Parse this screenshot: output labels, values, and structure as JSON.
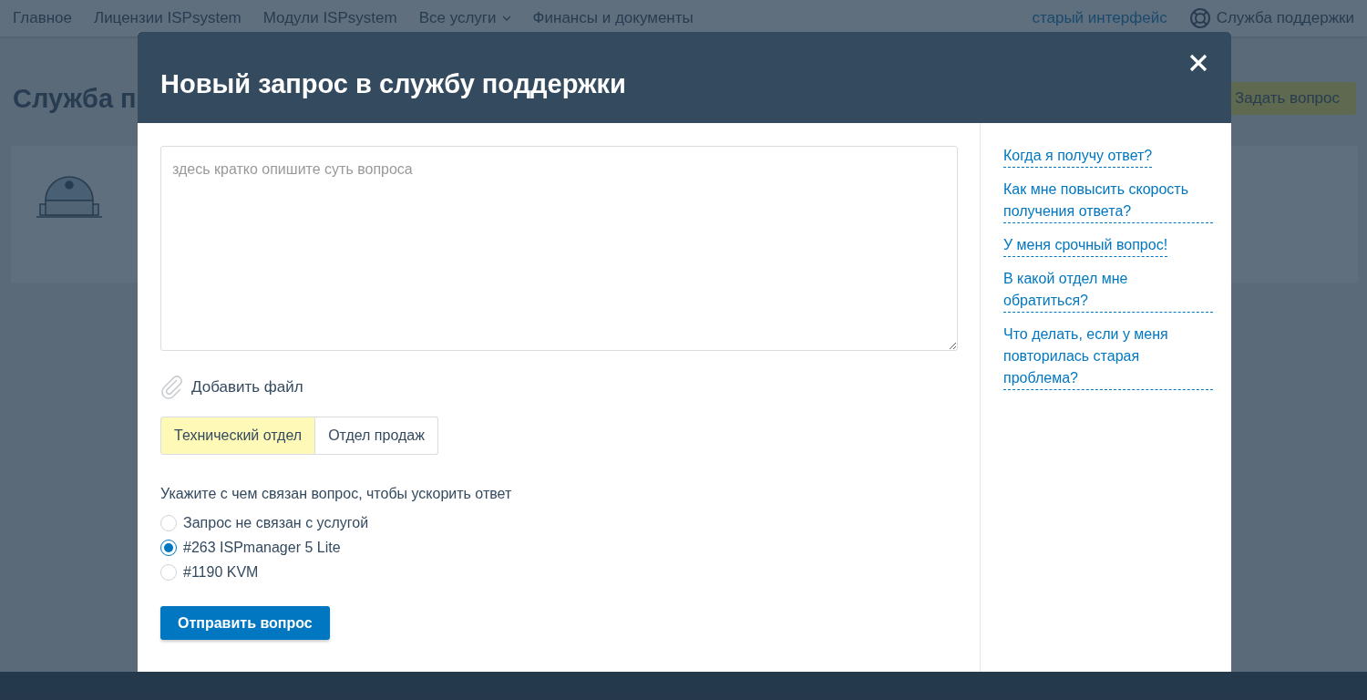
{
  "nav": {
    "items": [
      {
        "label": "Главное",
        "has_menu": false
      },
      {
        "label": "Лицензии ISPsystem",
        "has_menu": false
      },
      {
        "label": "Модули ISPsystem",
        "has_menu": false
      },
      {
        "label": "Все услуги",
        "has_menu": true
      },
      {
        "label": "Финансы и документы",
        "has_menu": false
      }
    ],
    "old_interface_link": "старый интерфейс",
    "support_link": "Служба поддержки"
  },
  "page": {
    "heading": "Служба п",
    "ask_button": "Задать вопрос"
  },
  "modal": {
    "title": "Новый запрос в службу поддержки",
    "question_field": {
      "placeholder": "здесь кратко опишите суть вопроса"
    },
    "attach_label": "Добавить файл",
    "departments": [
      {
        "label": "Технический отдел",
        "selected": true
      },
      {
        "label": "Отдел продаж",
        "selected": false
      }
    ],
    "service_prompt": "Укажите с чем связан вопрос, чтобы ускорить ответ",
    "services": [
      {
        "label": "Запрос не связан с услугой",
        "selected": false
      },
      {
        "label": "#263 ISPmanager 5 Lite",
        "selected": true
      },
      {
        "label": "#1190 KVM",
        "selected": false
      }
    ],
    "submit": "Отправить вопрос",
    "help_links": [
      "Когда я получу ответ?",
      "Как мне повысить скорость получения ответа?",
      "У меня срочный вопрос!",
      "В какой отдел мне обратиться?",
      "Что делать, если у меня повторилась старая проблема?"
    ]
  }
}
